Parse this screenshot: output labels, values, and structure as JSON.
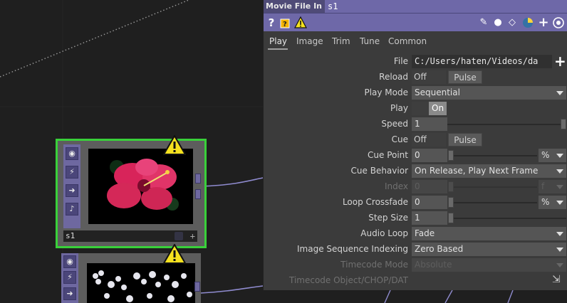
{
  "panel": {
    "op_type": "Movie File In",
    "op_name": "s1",
    "toolbar_icons": [
      "help-icon",
      "python-help-icon",
      "warning-icon",
      "edit-icon",
      "comment-icon",
      "tag-icon",
      "python-icon",
      "add-icon",
      "viewer-icon"
    ],
    "tabs": [
      "Play",
      "Image",
      "Trim",
      "Tune",
      "Common"
    ],
    "active_tab": "Play",
    "params": {
      "file": {
        "label": "File",
        "value": "C:/Users/haten/Videos/da"
      },
      "reload": {
        "label": "Reload",
        "off": "Off",
        "pulse": "Pulse"
      },
      "play_mode": {
        "label": "Play Mode",
        "value": "Sequential"
      },
      "play": {
        "label": "Play",
        "on": "On"
      },
      "speed": {
        "label": "Speed",
        "value": "1"
      },
      "cue": {
        "label": "Cue",
        "off": "Off",
        "pulse": "Pulse"
      },
      "cue_point": {
        "label": "Cue Point",
        "value": "0",
        "unit": "%"
      },
      "cue_behavior": {
        "label": "Cue Behavior",
        "value": "On Release, Play Next Frame"
      },
      "index": {
        "label": "Index",
        "value": "0",
        "unit": "f"
      },
      "loop_crossfade": {
        "label": "Loop Crossfade",
        "value": "0",
        "unit": "%"
      },
      "step_size": {
        "label": "Step Size",
        "value": "1"
      },
      "audio_loop": {
        "label": "Audio Loop",
        "value": "Fade"
      },
      "image_sequence_indexing": {
        "label": "Image Sequence Indexing",
        "value": "Zero Based"
      },
      "timecode_mode": {
        "label": "Timecode Mode",
        "value": "Absolute"
      },
      "timecode_object": {
        "label": "Timecode Object/CHOP/DAT"
      }
    }
  },
  "network": {
    "node1": {
      "name": "s1"
    },
    "node2": {
      "name": ""
    }
  }
}
